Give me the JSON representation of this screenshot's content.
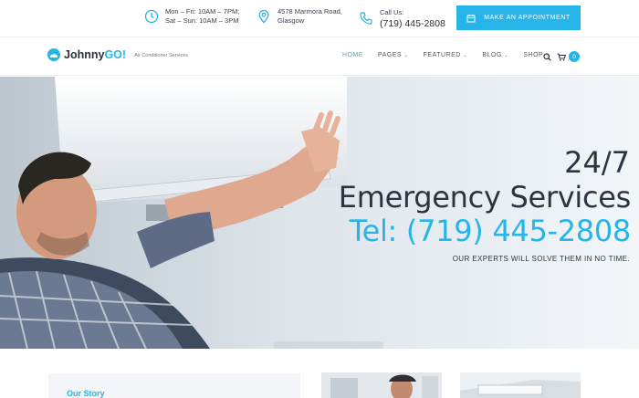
{
  "topbar": {
    "hours": {
      "line1": "Mon – Fri: 10AM – 7PM;",
      "line2": "Sat – Sun: 10AM – 3PM",
      "icon": "clock-icon"
    },
    "address": {
      "line1": "4578 Marmora Road,",
      "line2": "Glasgow",
      "icon": "map-pin-icon"
    },
    "phone": {
      "label": "Call Us:",
      "number": "(719) 445-2808",
      "icon": "phone-icon"
    },
    "cta_label": "MAKE AN APPOINTMENT",
    "cta_icon": "calendar-icon"
  },
  "nav": {
    "logo": {
      "name_part1": "Johnny",
      "name_part2": "GO!",
      "tagline": "Air Conditioner Services"
    },
    "items": [
      {
        "label": "HOME",
        "active": true,
        "dropdown": false
      },
      {
        "label": "PAGES",
        "active": false,
        "dropdown": true
      },
      {
        "label": "FEATURED",
        "active": false,
        "dropdown": true
      },
      {
        "label": "BLOG",
        "active": false,
        "dropdown": true
      },
      {
        "label": "SHOP",
        "active": false,
        "dropdown": true
      }
    ],
    "cart_count": "0"
  },
  "hero": {
    "line1": "24/7",
    "line2": "Emergency Services",
    "line3": "Tel: (719) 445-2808",
    "subtitle": "OUR EXPERTS WILL SOLVE THEM IN NO TIME."
  },
  "bottom": {
    "story_title": "Our Story"
  },
  "colors": {
    "accent": "#27b4e8",
    "dark": "#2d3440"
  }
}
